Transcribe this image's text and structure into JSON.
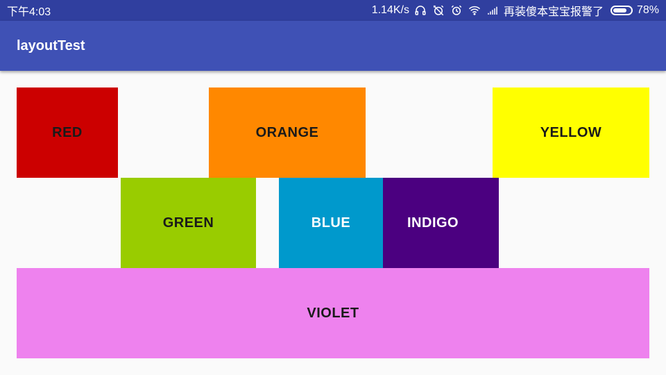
{
  "status_bar": {
    "time": "下午4:03",
    "network_speed": "1.14K/s",
    "icons": [
      "headphones-icon",
      "alarm-off-icon",
      "alarm-icon",
      "wifi-icon",
      "signal-icon"
    ],
    "carrier_text": "再装傻本宝宝报警了",
    "battery_percent": "78%",
    "battery_level": 0.78
  },
  "app_bar": {
    "title": "layoutTest",
    "color": "#3f51b5",
    "status_color": "#303f9f"
  },
  "blocks": [
    {
      "id": "red",
      "label": "RED",
      "color": "#cc0000",
      "text_color": "#1a1a1a"
    },
    {
      "id": "orange",
      "label": "ORANGE",
      "color": "#ff8800",
      "text_color": "#1a1a1a"
    },
    {
      "id": "yellow",
      "label": "YELLOW",
      "color": "#ffff00",
      "text_color": "#1a1a1a"
    },
    {
      "id": "green",
      "label": "GREEN",
      "color": "#99cc00",
      "text_color": "#1a1a1a"
    },
    {
      "id": "blue",
      "label": "BLUE",
      "color": "#0099cc",
      "text_color": "#ffffff"
    },
    {
      "id": "indigo",
      "label": "INDIGO",
      "color": "#4b0080",
      "text_color": "#ffffff"
    },
    {
      "id": "violet",
      "label": "VIOLET",
      "color": "#ee82ee",
      "text_color": "#1a1a1a"
    }
  ]
}
